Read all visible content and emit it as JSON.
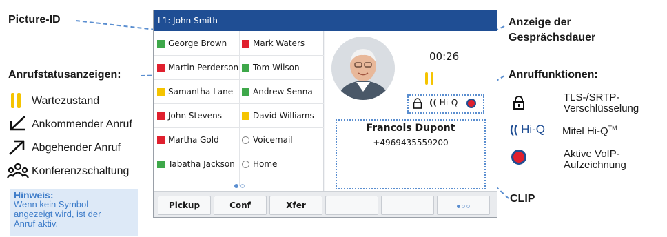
{
  "annotations": {
    "picture_id": "Picture-ID",
    "call_duration_line1": "Anzeige der",
    "call_duration_line2": "Gesprächsdauer",
    "call_status_title": "Anrufstatusanzeigen:",
    "call_features_title": "Anruffunktionen:",
    "clip": "CLIP"
  },
  "legend": {
    "hold": "Wartezustand",
    "incoming": "Ankommender Anruf",
    "outgoing": "Abgehender Anruf",
    "conference": "Konferenzschaltung"
  },
  "note": {
    "title": "Hinweis:",
    "line1": "Wenn kein Symbol",
    "line2": "angezeigt wird, ist der",
    "line3": "Anruf aktiv."
  },
  "features": {
    "tls_line1": "TLS-/SRTP-",
    "tls_line2": "Verschlüsselung",
    "hiq_logo": "Hi-Q",
    "hiq_label": "Mitel Hi-Q",
    "hiq_tm": "TM",
    "voip_line1": "Aktive VoIP-",
    "voip_line2": "Aufzeichnung"
  },
  "phone": {
    "line_label": "L1: John Smith",
    "contacts_left": [
      {
        "name": "George Brown",
        "status": "green"
      },
      {
        "name": "Martin Perderson",
        "status": "red"
      },
      {
        "name": "Samantha Lane",
        "status": "yellow"
      },
      {
        "name": "John Stevens",
        "status": "red"
      },
      {
        "name": "Martha Gold",
        "status": "red"
      },
      {
        "name": "Tabatha Jackson",
        "status": "green"
      }
    ],
    "contacts_right": [
      {
        "name": "Mark Waters",
        "status": "red"
      },
      {
        "name": "Tom Wilson",
        "status": "green"
      },
      {
        "name": "Andrew Senna",
        "status": "green"
      },
      {
        "name": "David Williams",
        "status": "yellow"
      },
      {
        "name": "Voicemail",
        "status": "none"
      },
      {
        "name": "Home",
        "status": "none"
      }
    ],
    "call": {
      "duration": "00:26",
      "caller_name": "Francois Dupont",
      "caller_number": "+4969435559200",
      "hiq_badge": "Hi-Q"
    },
    "softkeys": [
      "Pickup",
      "Conf",
      "Xfer",
      "",
      "",
      ""
    ]
  },
  "colors": {
    "header": "#1f4e94",
    "green": "#3ea84a",
    "red": "#e0202e",
    "yellow": "#f5c400",
    "annotation_blue": "#5a8ed0",
    "note_bg": "#dde9f7",
    "note_text": "#3d7cc9",
    "hold_bar": "#f5c400"
  }
}
